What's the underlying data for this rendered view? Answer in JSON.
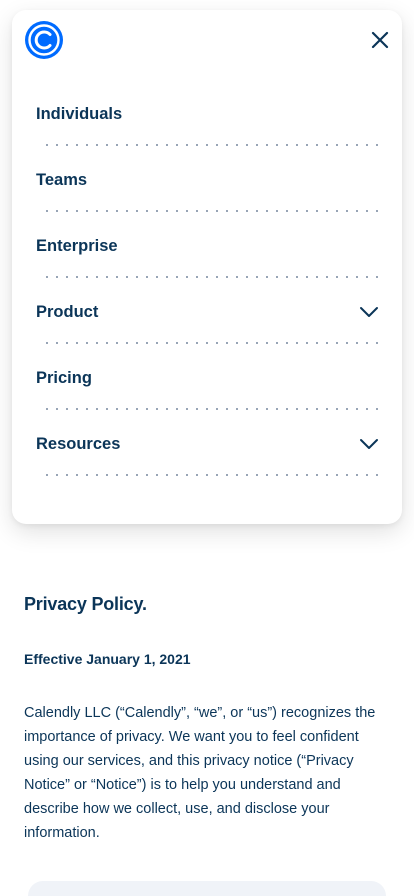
{
  "header": {
    "logo_icon": "calendly-logo-icon",
    "close_icon": "close-icon",
    "brand_color": "#006bff"
  },
  "nav": {
    "items": [
      {
        "label": "Individuals",
        "has_dropdown": false
      },
      {
        "label": "Teams",
        "has_dropdown": false
      },
      {
        "label": "Enterprise",
        "has_dropdown": false
      },
      {
        "label": "Product",
        "has_dropdown": true
      },
      {
        "label": "Pricing",
        "has_dropdown": false
      },
      {
        "label": "Resources",
        "has_dropdown": true
      }
    ]
  },
  "policy": {
    "title": "Privacy Policy.",
    "effective": "Effective January 1, 2021",
    "body": "Calendly LLC (“Calendly”, “we”, or “us”) recognizes the importance of privacy. We want you to feel confident using our services, and this privacy notice (“Privacy Notice” or “Notice”) is to help you understand and describe how we collect, use, and disclose your information."
  },
  "colors": {
    "text": "#0b3558",
    "dots": "#7e8ea3"
  }
}
